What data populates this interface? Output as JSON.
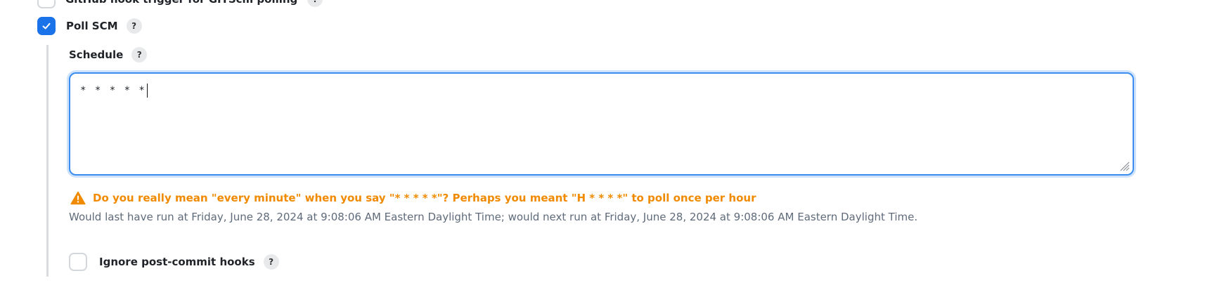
{
  "build_triggers": {
    "top_option_label": "GitHub hook trigger for GITScm polling",
    "top_option_checked": false,
    "poll_scm": {
      "label": "Poll SCM",
      "checked": true,
      "help_glyph": "?",
      "schedule": {
        "label": "Schedule",
        "help_glyph": "?",
        "value": "* * * * *",
        "warning_text": "Do you really mean \"every minute\" when you say \"* * * * *\"? Perhaps you meant \"H * * * *\" to poll once per hour",
        "info_text": "Would last have run at Friday, June 28, 2024 at 9:08:06 AM Eastern Daylight Time; would next run at Friday, June 28, 2024 at 9:08:06 AM Eastern Daylight Time."
      },
      "ignore_hooks": {
        "label": "Ignore post-commit hooks",
        "checked": false,
        "help_glyph": "?"
      }
    }
  },
  "colors": {
    "accent": "#1a73e8",
    "warning": "#f08a00",
    "info_text": "#5f6b7a",
    "focus_border": "#3b8ef0"
  },
  "icons": {
    "checked": "checkmark-icon",
    "warning": "warning-triangle-icon",
    "help": "help-icon",
    "resize": "resize-handle-icon"
  }
}
